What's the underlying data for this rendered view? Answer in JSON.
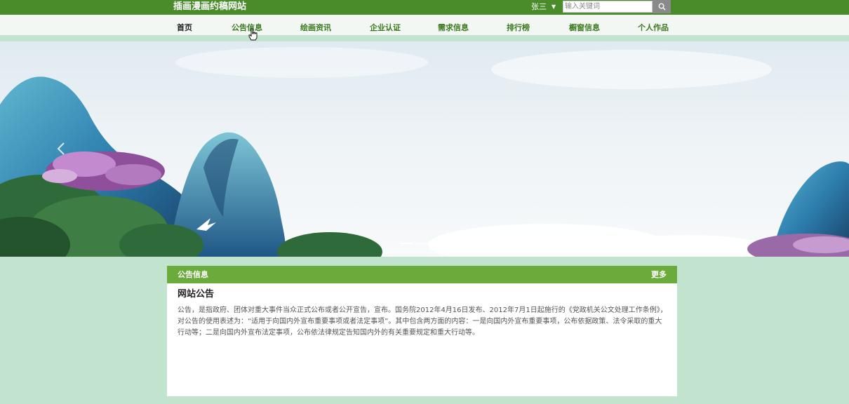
{
  "header": {
    "site_title": "插画漫画约稿网站",
    "user_name": "张三",
    "search_placeholder": "输入关键词"
  },
  "nav": {
    "items": [
      {
        "label": "首页"
      },
      {
        "label": "公告信息"
      },
      {
        "label": "绘画资讯"
      },
      {
        "label": "企业认证"
      },
      {
        "label": "需求信息"
      },
      {
        "label": "排行榜"
      },
      {
        "label": "橱窗信息"
      },
      {
        "label": "个人作品"
      }
    ]
  },
  "banner": {
    "slide_count": 3,
    "active_slide": 1
  },
  "notice_panel": {
    "title": "公告信息",
    "more_label": "更多",
    "notice_title": "网站公告",
    "notice_body": "公告，是指政府、团体对重大事件当众正式公布或者公开宣告，宣布。国务院2012年4月16日发布、2012年7月1日起施行的《党政机关公文处理工作条例》，对公告的使用表述为：“适用于向国内外宣布重要事项或者法定事项”。其中包含两方面的内容：一是向国内外宣布重要事项，公布依据政策、法令采取的重大行动等；二是向国内外宣布法定事项，公布依法律规定告知国内外的有关重要规定和重大行动等。"
  },
  "colors": {
    "topbar": "#4a8c2a",
    "nav_text": "#3b7a1e",
    "panel_header": "#6aab3b",
    "page_background": "#c2e3cd"
  },
  "icons": [
    "search-icon",
    "caret-down-icon",
    "chevron-left-icon",
    "hand-cursor-icon"
  ]
}
